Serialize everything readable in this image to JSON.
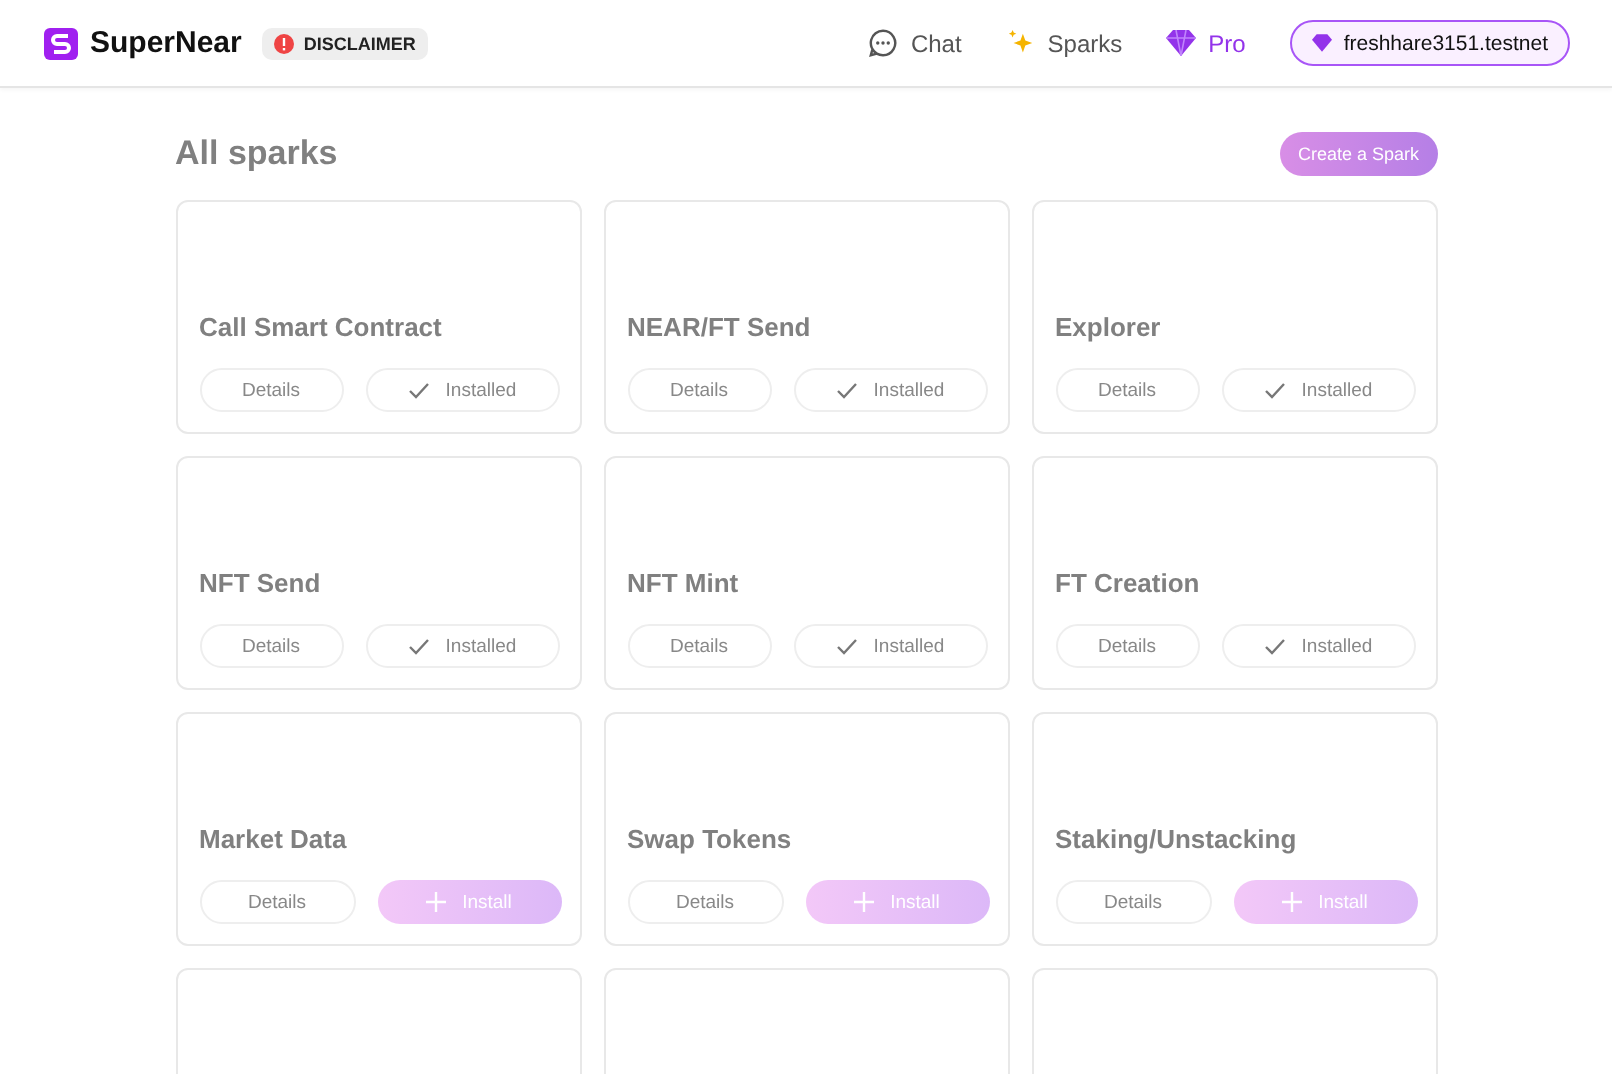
{
  "header": {
    "brand": "SuperNear",
    "disclaimer": "DISCLAIMER",
    "nav": [
      {
        "label": "Chat",
        "kind": "chat"
      },
      {
        "label": "Sparks",
        "kind": "sparks"
      },
      {
        "label": "Pro",
        "kind": "pro"
      }
    ],
    "account": "freshhare3151.testnet"
  },
  "page": {
    "title": "All sparks",
    "create_button": "Create a Spark"
  },
  "sparks": [
    {
      "title": "Call Smart Contract",
      "details": "Details",
      "action": "Installed",
      "installed": true
    },
    {
      "title": "NEAR/FT Send",
      "details": "Details",
      "action": "Installed",
      "installed": true
    },
    {
      "title": "Explorer",
      "details": "Details",
      "action": "Installed",
      "installed": true
    },
    {
      "title": "NFT Send",
      "details": "Details",
      "action": "Installed",
      "installed": true
    },
    {
      "title": "NFT Mint",
      "details": "Details",
      "action": "Installed",
      "installed": true
    },
    {
      "title": "FT Creation",
      "details": "Details",
      "action": "Installed",
      "installed": true
    },
    {
      "title": "Market Data",
      "details": "Details",
      "action": "Install",
      "installed": false
    },
    {
      "title": "Swap Tokens",
      "details": "Details",
      "action": "Install",
      "installed": false
    },
    {
      "title": "Staking/Unstacking",
      "details": "Details",
      "action": "Install",
      "installed": false
    }
  ]
}
